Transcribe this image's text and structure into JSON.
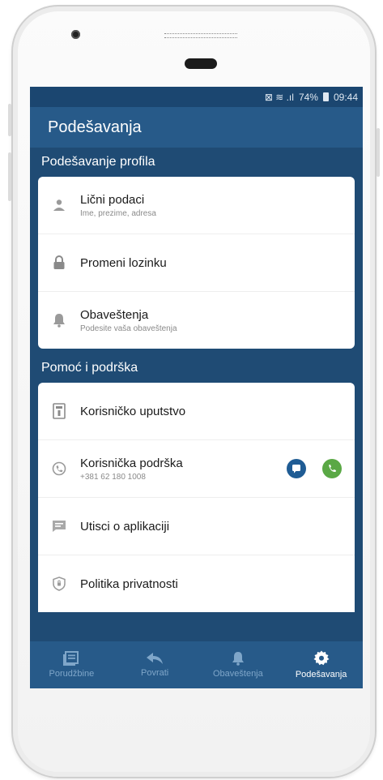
{
  "status": {
    "icons": "⊠ ≋ .ıl",
    "battery": "74%",
    "time": "09:44"
  },
  "appbar": {
    "title": "Podešavanja"
  },
  "sections": [
    {
      "title": "Podešavanje profila",
      "items": [
        {
          "label": "Lični podaci",
          "sub": "Ime, prezime, adresa",
          "icon": "person-icon"
        },
        {
          "label": "Promeni lozinku",
          "sub": "",
          "icon": "lock-icon"
        },
        {
          "label": "Obaveštenja",
          "sub": "Podesite vaša obaveštenja",
          "icon": "bell-icon"
        }
      ]
    },
    {
      "title": "Pomoć i podrška",
      "items": [
        {
          "label": "Korisničko uputstvo",
          "sub": "",
          "icon": "manual-icon"
        },
        {
          "label": "Korisnička podrška",
          "sub": "+381 62 180 1008",
          "icon": "support-icon"
        },
        {
          "label": "Utisci o aplikaciji",
          "sub": "",
          "icon": "feedback-icon"
        },
        {
          "label": "Politika privatnosti",
          "sub": "",
          "icon": "privacy-shield-icon"
        }
      ]
    }
  ],
  "nav": [
    {
      "label": "Porudžbine",
      "icon": "orders-icon",
      "active": false
    },
    {
      "label": "Povrati",
      "icon": "reply-icon",
      "active": false
    },
    {
      "label": "Obaveštenja",
      "icon": "bell-icon",
      "active": false
    },
    {
      "label": "Podešavanja",
      "icon": "gear-icon",
      "active": true
    }
  ],
  "colors": {
    "primary": "#275a89",
    "dark": "#1f4b74",
    "chat": "#1f5c94",
    "call": "#5aa845"
  }
}
